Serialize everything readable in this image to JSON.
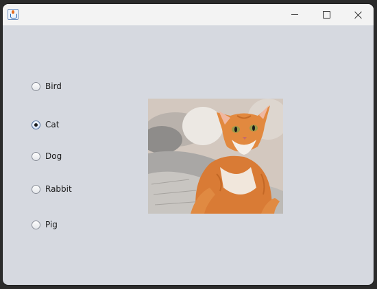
{
  "window": {
    "title": "",
    "icon": "java-cup-icon"
  },
  "titlebar_controls": {
    "minimize": "minimize-icon",
    "maximize": "maximize-icon",
    "close": "close-icon"
  },
  "radio_options": [
    {
      "label": "Bird",
      "selected": false
    },
    {
      "label": "Cat",
      "selected": true
    },
    {
      "label": "Dog",
      "selected": false
    },
    {
      "label": "Rabbit",
      "selected": false
    },
    {
      "label": "Pig",
      "selected": false
    }
  ],
  "image": {
    "subject": "orange tabby cat lying on a grey blanket",
    "accent_colors": [
      "#d97b35",
      "#f2efe9",
      "#9aa0a6"
    ]
  },
  "colors": {
    "background": "#d6d9e0",
    "titlebar": "#f3f3f3"
  }
}
